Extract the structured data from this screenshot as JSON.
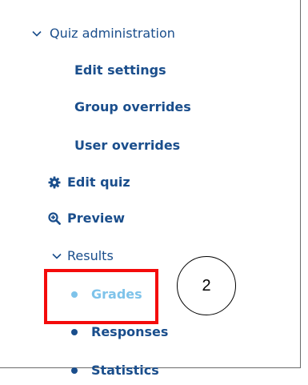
{
  "nav": {
    "quiz_admin": {
      "label": "Quiz administration",
      "icon": "chevron-down-icon"
    },
    "edit_settings": "Edit settings",
    "group_overrides": "Group overrides",
    "user_overrides": "User overrides",
    "edit_quiz": {
      "label": "Edit quiz",
      "icon": "gear-icon"
    },
    "preview": {
      "label": "Preview",
      "icon": "zoom-in-icon"
    },
    "results": {
      "label": "Results",
      "icon": "chevron-down-icon",
      "items": [
        {
          "label": "Grades",
          "active": true
        },
        {
          "label": "Responses",
          "active": false
        },
        {
          "label": "Statistics",
          "active": false
        }
      ]
    }
  },
  "annotation": {
    "number": "2"
  },
  "colors": {
    "link": "#1a4e8c",
    "active_link": "#7ec3ea",
    "highlight_box": "#f40b0b"
  }
}
